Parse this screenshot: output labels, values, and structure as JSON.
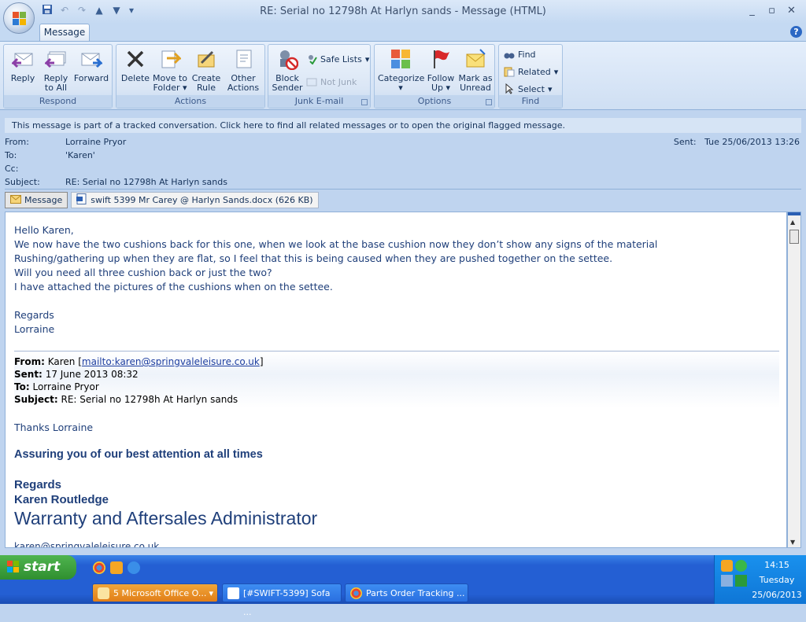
{
  "window": {
    "title": "RE: Serial no 12798h At Harlyn sands - Message (HTML)",
    "minimize": "_",
    "restore": "▫",
    "close": "✕"
  },
  "tabs": {
    "message": "Message"
  },
  "help": "?",
  "ribbon": {
    "respond": {
      "label": "Respond",
      "reply": "Reply",
      "reply_all_1": "Reply",
      "reply_all_2": "to All",
      "forward": "Forward"
    },
    "actions": {
      "label": "Actions",
      "delete": "Delete",
      "move_1": "Move to",
      "move_2": "Folder",
      "create_1": "Create",
      "create_2": "Rule",
      "other_1": "Other",
      "other_2": "Actions"
    },
    "junk": {
      "label": "Junk E-mail",
      "block_1": "Block",
      "block_2": "Sender",
      "safe_lists": "Safe Lists",
      "not_junk": "Not Junk"
    },
    "options": {
      "label": "Options",
      "categorize": "Categorize",
      "follow_1": "Follow",
      "follow_2": "Up",
      "mark_1": "Mark as",
      "mark_2": "Unread"
    },
    "find": {
      "label": "Find",
      "find": "Find",
      "related": "Related",
      "select": "Select"
    }
  },
  "info_bar": "This message is part of a tracked conversation. Click here to find all related messages or to open the original flagged message.",
  "header": {
    "from_label": "From:",
    "from": "Lorraine Pryor",
    "to_label": "To:",
    "to": "'Karen'",
    "cc_label": "Cc:",
    "cc": "",
    "subject_label": "Subject:",
    "subject": "RE: Serial no 12798h At Harlyn sands",
    "sent_label": "Sent:",
    "sent": "Tue 25/06/2013 13:26"
  },
  "attachments": {
    "message": "Message",
    "file": "swift 5399 Mr Carey @ Harlyn Sands.docx (626 KB)"
  },
  "body": {
    "lines": [
      "Hello Karen,",
      "We now have the two cushions back for this one, when we look at the base cushion now they don’t show any signs of the material",
      "Rushing/gathering up when they are flat, so I feel that this is being caused when they are pushed together on the settee.",
      "Will you need all three cushion back or just the two?",
      "I have attached the pictures of the cushions when on the settee."
    ],
    "regards": "Regards",
    "signature": "Lorraine",
    "quoted": {
      "from_label": "From:",
      "from_name": "Karen [",
      "from_link": "mailto:karen@springvaleleisure.co.uk",
      "from_end": "]",
      "sent_label": "Sent:",
      "sent": "17 June 2013 08:32",
      "to_label": "To:",
      "to": "Lorraine Pryor",
      "subject_label": "Subject:",
      "subject": "RE: Serial no 12798h At Harlyn sands"
    },
    "reply_thanks": "Thanks Lorraine",
    "reply_assuring": "Assuring you of our best attention at all times",
    "reply_regards": "Regards",
    "reply_name": "Karen Routledge",
    "reply_title": "Warranty and Aftersales Administrator",
    "reply_email_partial": "karen@springvaleleisure.co.uk"
  },
  "taskbar": {
    "start": "start",
    "buttons": [
      "5 Microsoft Office O...",
      "[#SWIFT-5399] Sofa ...",
      "Parts Order Tracking ..."
    ],
    "clock_time": "14:15",
    "clock_day": "Tuesday",
    "clock_date": "25/06/2013"
  },
  "colors": {
    "accent": "#245fd3",
    "ribbon": "#dae6f5",
    "text": "#15325a"
  }
}
